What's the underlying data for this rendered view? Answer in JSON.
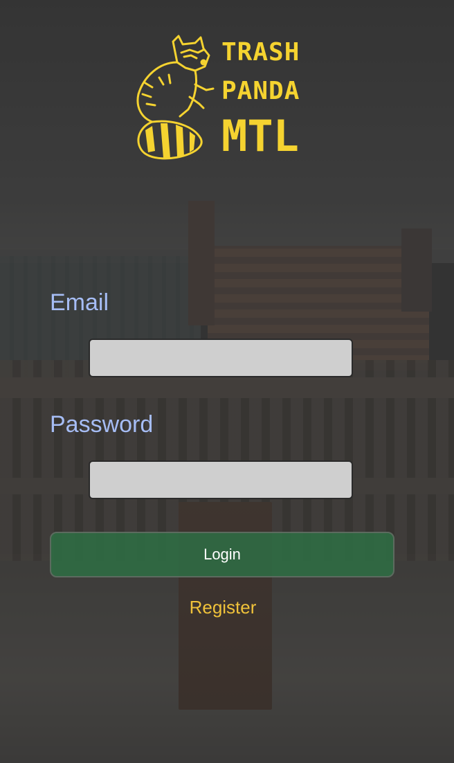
{
  "logo": {
    "line1": "TRASH",
    "line2": "PANDA",
    "line3": "MTL",
    "icon": "raccoon-icon",
    "color": "#f5d330"
  },
  "form": {
    "email_label": "Email",
    "email_value": "",
    "password_label": "Password",
    "password_value": "",
    "login_label": "Login",
    "register_label": "Register"
  },
  "colors": {
    "label": "#a6bdf5",
    "login_button": "#2e6e44",
    "register_link": "#f0c23a",
    "input_bg": "#cfcfcf"
  }
}
